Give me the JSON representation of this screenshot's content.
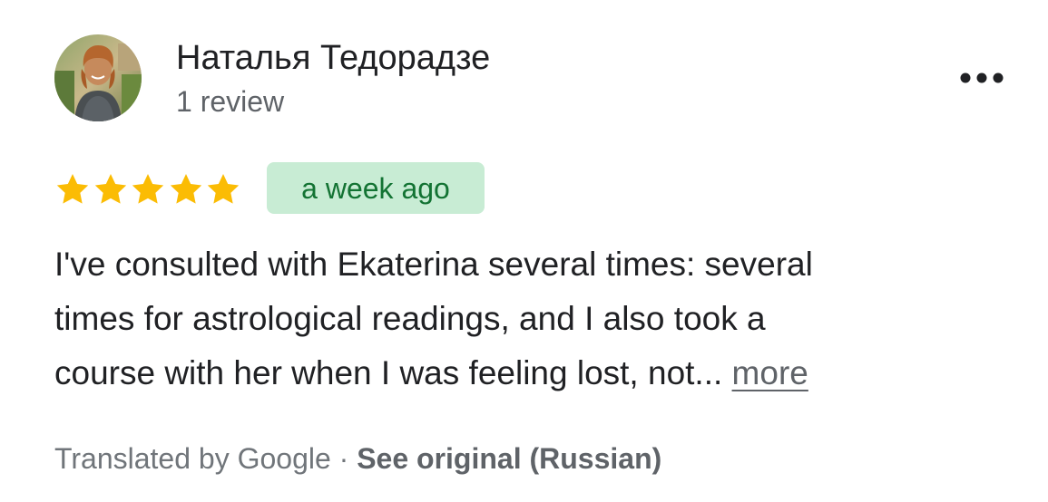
{
  "reviewer": {
    "name": "Наталья Тедорадзе",
    "review_count": "1 review"
  },
  "rating": {
    "stars": 5,
    "max_stars": 5,
    "star_color": "#fbbc04"
  },
  "date_badge": {
    "text": "a week ago",
    "background": "#c8ecd4",
    "text_color": "#137333"
  },
  "review": {
    "lines": [
      "I've consulted with Ekaterina several times: several",
      "times for astrological readings, and I also took a",
      "course with her when I was feeling lost, not..."
    ],
    "more_label": "more"
  },
  "translation": {
    "label": "Translated by Google",
    "separator": "·",
    "see_original_label": "See original (Russian)"
  },
  "icons": {
    "menu": "more-horiz-icon",
    "star": "star-icon"
  }
}
